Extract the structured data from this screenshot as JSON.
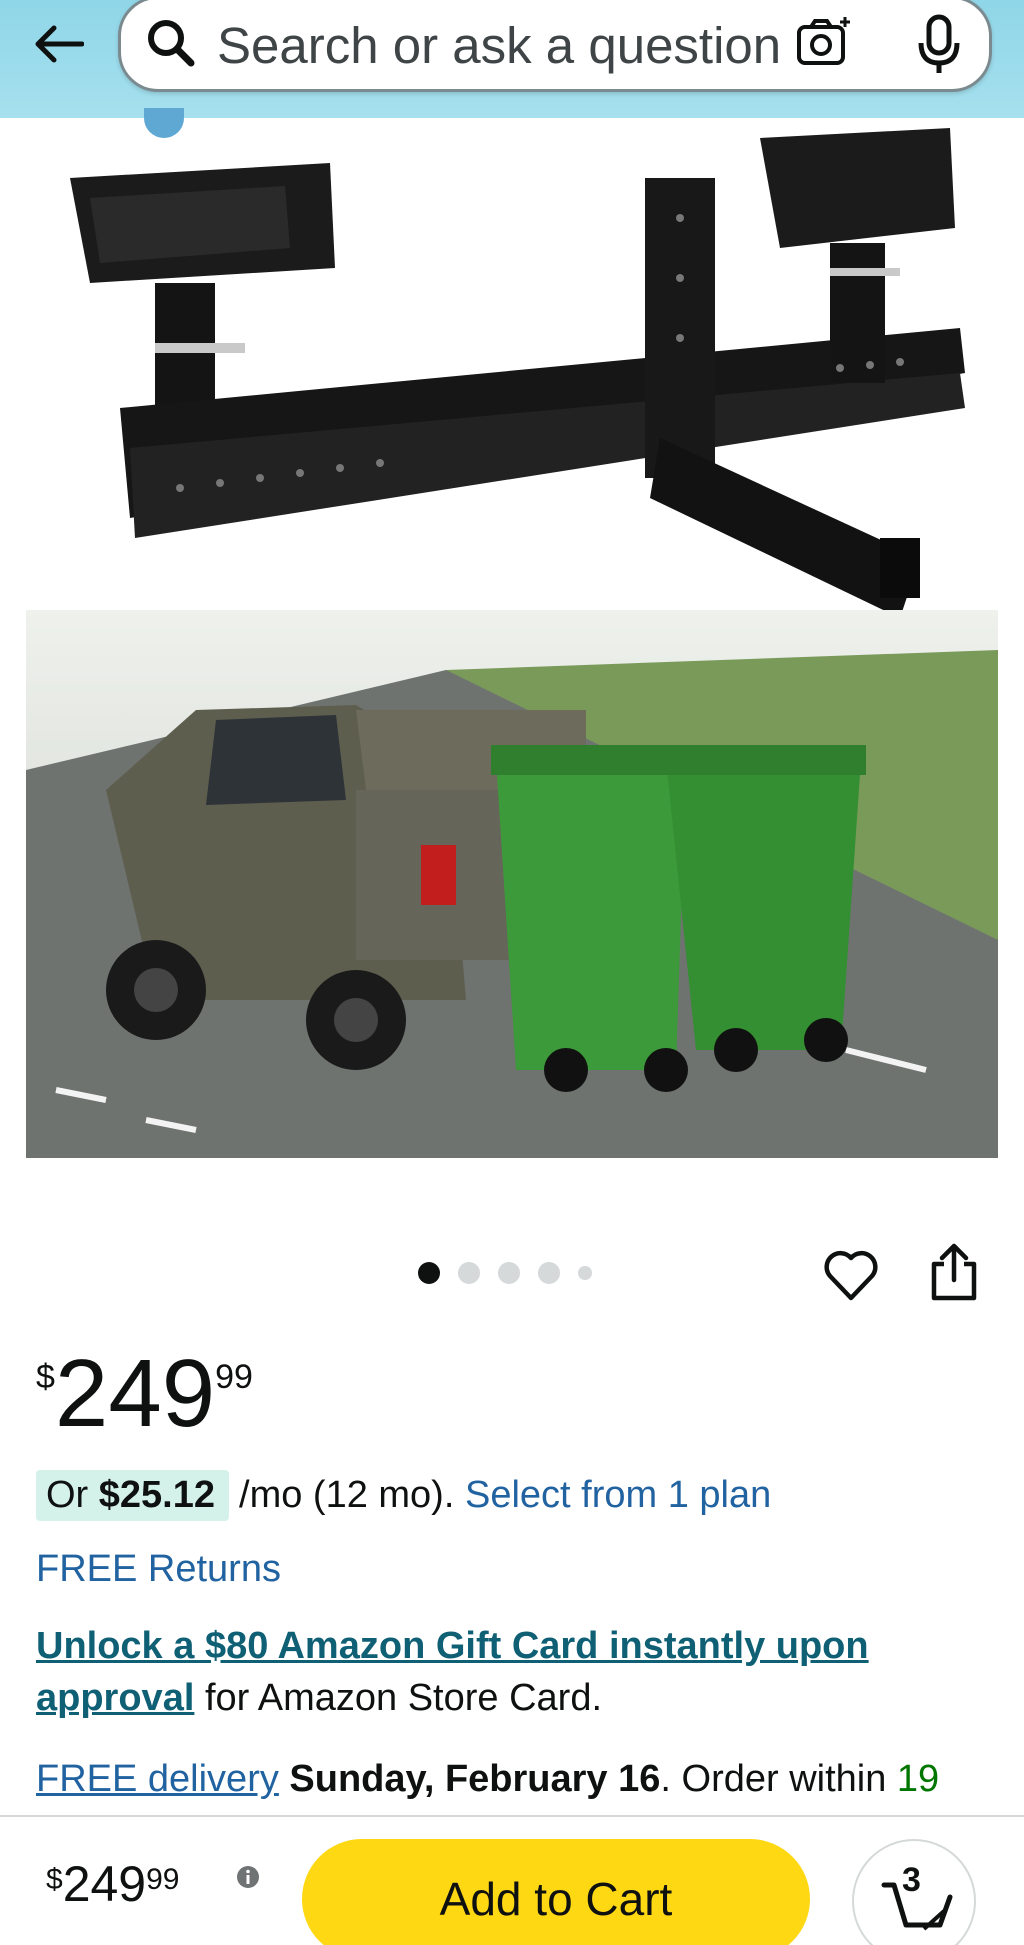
{
  "header": {
    "search_placeholder": "Search or ask a question"
  },
  "carousel": {
    "total_dots": 5,
    "active_index": 0
  },
  "price": {
    "symbol": "$",
    "whole": "249",
    "fraction": "99"
  },
  "monthly": {
    "prefix": "Or ",
    "amount": "$25.12",
    "term": "/mo (12 mo).",
    "plan_link": "Select from 1 plan"
  },
  "free_returns": "FREE Returns",
  "gift": {
    "link": "Unlock a $80 Amazon Gift Card instantly upon approval",
    "suffix": " for Amazon Store Card."
  },
  "delivery": {
    "link": "FREE delivery",
    "date": "Sunday, February 16",
    "order_within": ". Order within ",
    "time": "19"
  },
  "bottom_bar": {
    "symbol": "$",
    "whole": "249",
    "fraction": "99",
    "add_to_cart": "Add to Cart",
    "cart_count": "3"
  },
  "colors": {
    "header_bg": "#a6e0ee",
    "cta_yellow": "#ffd814",
    "link_blue": "#2162a1",
    "chip_green": "#d4f2ea"
  }
}
